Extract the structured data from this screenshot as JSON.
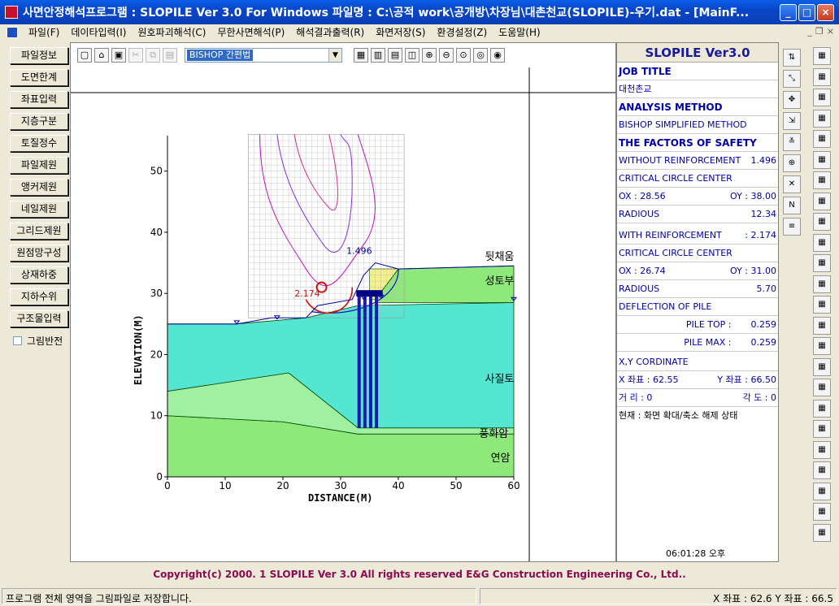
{
  "window": {
    "title": "사면안정해석프로그램 : SLOPILE Ver 3.0 For Windows 파일명 : C:\\공적 work\\공개방\\차장님\\대촌천교(SLOPILE)-우기.dat - [MainF...",
    "min_label": "_",
    "max_label": "□",
    "close_label": "×"
  },
  "menu": {
    "items": [
      "파일(F)",
      "데이타입력(I)",
      "원호파괴해석(C)",
      "무한사면해석(P)",
      "해석결과출력(R)",
      "화면저장(S)",
      "환경설정(Z)",
      "도움말(H)"
    ],
    "mdi_min": "_",
    "mdi_restore": "❐",
    "mdi_close": "×"
  },
  "left_panel": {
    "buttons": [
      "파일정보",
      "도면한계",
      "좌표입력",
      "지층구분",
      "토질정수",
      "파일제원",
      "앵커제원",
      "네일제원",
      "그리드제원",
      "원점망구성",
      "상재하중",
      "지하수위",
      "구조물입력"
    ],
    "checkbox_label": "그림반전"
  },
  "toolbar": {
    "method_value": "BISHOP 간편법",
    "icons": [
      "new-icon",
      "open-icon",
      "save-icon",
      "cut-icon",
      "copy-icon",
      "paste-icon"
    ],
    "view_icons": [
      "view1-icon",
      "view2-icon",
      "view3-icon",
      "view4-icon",
      "zoom-in-icon",
      "zoom-out-icon",
      "zoom-window-icon",
      "zoom-all-icon",
      "zoom-prev-icon"
    ]
  },
  "chart_data": {
    "type": "line",
    "xlabel": "DISTANCE(M)",
    "ylabel": "ELEVATION(M)",
    "xlim": [
      0,
      60
    ],
    "ylim": [
      0,
      55
    ],
    "xticks": [
      0,
      10,
      20,
      30,
      40,
      50,
      60
    ],
    "yticks": [
      0,
      10,
      20,
      30,
      40,
      50
    ],
    "layer_labels": [
      "뒷채움",
      "성토부",
      "사질토",
      "풍화암",
      "연암"
    ],
    "fs_labels": [
      "1.496",
      "2.174"
    ],
    "layers": [
      {
        "name": "연암",
        "color": "#8fe87a",
        "poly": [
          [
            0,
            10
          ],
          [
            20,
            9
          ],
          [
            33,
            7
          ],
          [
            60,
            8
          ],
          [
            60,
            0
          ],
          [
            0,
            0
          ]
        ]
      },
      {
        "name": "풍화암",
        "color": "#9ff0a0",
        "poly": [
          [
            0,
            14
          ],
          [
            21,
            17
          ],
          [
            33,
            8
          ],
          [
            60,
            8
          ],
          [
            60,
            7
          ],
          [
            33,
            7
          ],
          [
            20,
            9
          ],
          [
            0,
            10
          ]
        ]
      },
      {
        "name": "사질토",
        "color": "#55e6d2",
        "poly": [
          [
            0,
            25
          ],
          [
            12,
            25
          ],
          [
            24,
            26
          ],
          [
            33,
            28
          ],
          [
            60,
            28.5
          ],
          [
            60,
            8
          ],
          [
            33,
            8
          ],
          [
            21,
            17
          ],
          [
            0,
            14
          ]
        ]
      },
      {
        "name": "성토부",
        "color": "#8fe87a",
        "poly": [
          [
            36,
            29
          ],
          [
            40,
            34
          ],
          [
            60,
            34.5
          ],
          [
            60,
            28.5
          ],
          [
            36,
            28.5
          ]
        ]
      },
      {
        "name": "뒷채움",
        "color": "#f2f08a",
        "poly": [
          [
            35,
            29
          ],
          [
            35,
            34
          ],
          [
            40,
            34
          ],
          [
            36,
            29
          ]
        ]
      }
    ],
    "piles_x": [
      33.2,
      34.2,
      35.2,
      36.2
    ],
    "pile_bottom": 8,
    "pile_top": 30
  },
  "right_panel": {
    "header": "SLOPILE Ver3.0",
    "job_title_label": "JOB TITLE",
    "job_title": "대천촌교",
    "method_label": "ANALYSIS METHOD",
    "method": "BISHOP SIMPLIFIED METHOD",
    "fs_label": "THE FACTORS OF SAFETY",
    "without_label": "WITHOUT REINFORCEMENT",
    "without_value": "1.496",
    "ccc1": "CRITICAL CIRCLE CENTER",
    "ox1": "OX : 28.56",
    "oy1": "OY : 38.00",
    "radious1_label": "RADIOUS",
    "radious1": "12.34",
    "with_label": "WITH REINFORCEMENT",
    "with_value": ": 2.174",
    "ccc2": "CRITICAL CIRCLE CENTER",
    "ox2": "OX : 26.74",
    "oy2": "OY : 31.00",
    "radious2_label": "RADIOUS",
    "radious2": "5.70",
    "deflection_label": "DEFLECTION OF PILE",
    "pile_top_label": "PILE TOP :",
    "pile_top": "0.259",
    "pile_max_label": "PILE MAX :",
    "pile_max": "0.259",
    "xy_label": "X,Y CORDINATE",
    "x_coord": "X 좌표 :    62.55",
    "y_coord": "Y 좌표 :    66.50",
    "dist": "거  리 :   0",
    "angle": "각  도 :  0",
    "status": "현재 : 화면 확대/축소 해제 상태",
    "time": "06:01:28 오후"
  },
  "copyright": "Copyright(c) 2000. 1 SLOPILE Ver 3.0 All rights reserved E&G Construction Engineering Co., Ltd..",
  "statusbar": {
    "left": "프로그램 전체 영역을 그림파일로 저장합니다.",
    "right": "X 좌표 :   62.6 Y 좌표 :   66.5"
  }
}
